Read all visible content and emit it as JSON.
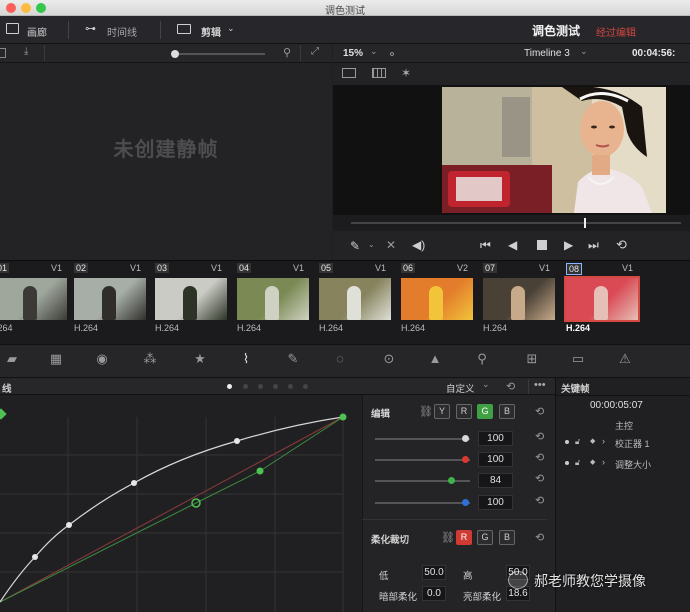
{
  "window": {
    "title": "调色测试"
  },
  "toolbar": {
    "gallery_label": "画廊",
    "timeline_label": "时间线",
    "clips_label": "剪辑",
    "project_name": "调色测试",
    "project_status": "经过编辑"
  },
  "gallery": {
    "empty_text": "未创建静帧"
  },
  "viewer": {
    "zoom": "15%",
    "timeline_name": "Timeline 3",
    "timecode": "00:04:56:"
  },
  "clips": [
    {
      "num": "01",
      "track": "V1",
      "codec": ".264",
      "selected": false
    },
    {
      "num": "02",
      "track": "V1",
      "codec": "H.264",
      "selected": false
    },
    {
      "num": "03",
      "track": "V1",
      "codec": "H.264",
      "selected": false
    },
    {
      "num": "04",
      "track": "V1",
      "codec": "H.264",
      "selected": false
    },
    {
      "num": "05",
      "track": "V1",
      "codec": "H.264",
      "selected": false
    },
    {
      "num": "06",
      "track": "V2",
      "codec": "H.264",
      "selected": false
    },
    {
      "num": "07",
      "track": "V1",
      "codec": "H.264",
      "selected": false
    },
    {
      "num": "08",
      "track": "V1",
      "codec": "H.264",
      "selected": true
    }
  ],
  "curves": {
    "title": "线",
    "mode_label": "自定义"
  },
  "edit": {
    "title": "编辑",
    "channels": [
      "Y",
      "R",
      "G",
      "B"
    ],
    "active_channel": "G",
    "sliders": [
      {
        "color": "#d8d8d8",
        "value": "100",
        "level": 1.0
      },
      {
        "color": "#d9392f",
        "value": "100",
        "level": 1.0
      },
      {
        "color": "#3fb34a",
        "value": "84",
        "level": 0.84
      },
      {
        "color": "#2f6fd8",
        "value": "100",
        "level": 1.0
      }
    ],
    "soft_clip_title": "柔化裁切",
    "soft_channels": [
      "R",
      "G",
      "B"
    ],
    "low_label": "低",
    "low_value": "50.0",
    "high_label": "高",
    "high_value": "50.0",
    "dark_soft_label": "暗部柔化",
    "dark_soft_value": "0.0",
    "bright_soft_label": "亮部柔化",
    "bright_soft_value": "18.6"
  },
  "keyframes": {
    "title": "关键帧",
    "timecode": "00:00:05:07",
    "master_label": "主控",
    "rows": [
      "校正器 1",
      "调整大小"
    ]
  },
  "watermark": {
    "text": "郝老师教您学摄像"
  }
}
